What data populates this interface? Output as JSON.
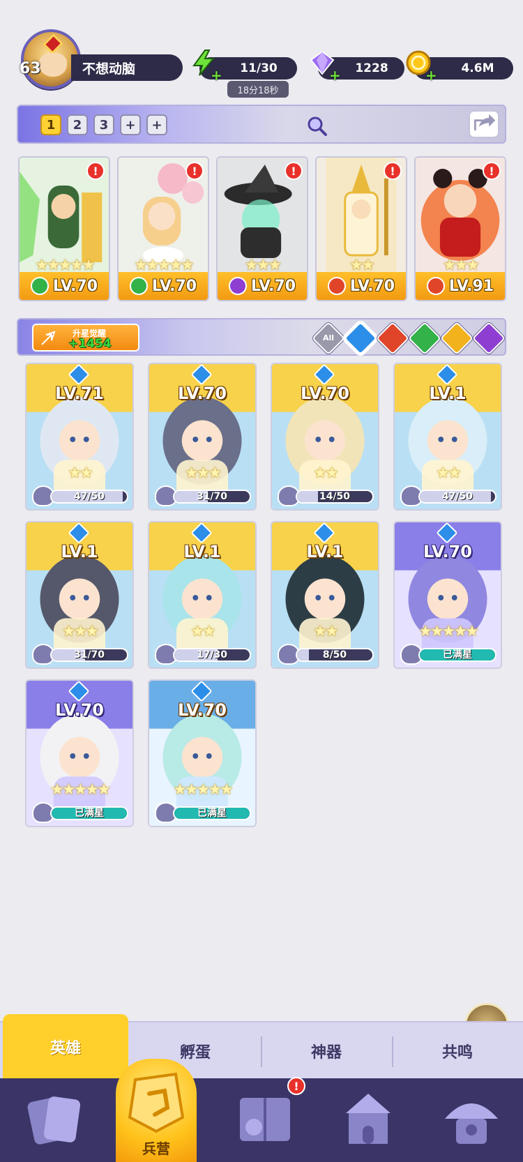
{
  "player": {
    "level": "63",
    "name": "不想动脑"
  },
  "resources": {
    "energy": "11/30",
    "energy_timer": "18分18秒",
    "gems": "1228",
    "gold": "4.6M"
  },
  "team_slots": [
    "1",
    "2",
    "3",
    "+",
    "+"
  ],
  "team": [
    {
      "element": "wind",
      "stars": 5,
      "level": "LV.70",
      "alert": "!"
    },
    {
      "element": "wind",
      "stars": 5,
      "level": "LV.70",
      "alert": "!"
    },
    {
      "element": "dark",
      "stars": 3,
      "level": "LV.70",
      "alert": "!"
    },
    {
      "element": "fire",
      "stars": 2,
      "level": "LV.70",
      "alert": "!"
    },
    {
      "element": "fire",
      "stars": 3,
      "level": "LV.91",
      "alert": "!"
    }
  ],
  "awaken": {
    "label": "升星觉醒",
    "value": "+1454"
  },
  "filters": [
    {
      "name": "all",
      "label": "All",
      "color": "#8a8aa0"
    },
    {
      "name": "water",
      "label": "",
      "color": "#2c8ee8"
    },
    {
      "name": "fire",
      "label": "",
      "color": "#e0452a"
    },
    {
      "name": "wind",
      "label": "",
      "color": "#33b24a"
    },
    {
      "name": "light",
      "label": "",
      "color": "#f2b21c"
    },
    {
      "name": "dark",
      "label": "",
      "color": "#8e3fd1"
    }
  ],
  "heroes": [
    {
      "level": "LV.71",
      "stars": 2,
      "progress": "47/50",
      "fill": 0.94,
      "theme": "gold"
    },
    {
      "level": "LV.70",
      "stars": 3,
      "progress": "31/70",
      "fill": 0.44,
      "theme": "gold"
    },
    {
      "level": "LV.70",
      "stars": 2,
      "progress": "14/50",
      "fill": 0.28,
      "theme": "gold"
    },
    {
      "level": "LV.1",
      "stars": 2,
      "progress": "47/50",
      "fill": 0.94,
      "theme": "gold"
    },
    {
      "level": "LV.1",
      "stars": 3,
      "progress": "31/70",
      "fill": 0.44,
      "theme": "gold"
    },
    {
      "level": "LV.1",
      "stars": 2,
      "progress": "17/30",
      "fill": 0.57,
      "theme": "gold"
    },
    {
      "level": "LV.1",
      "stars": 2,
      "progress": "8/50",
      "fill": 0.16,
      "theme": "gold"
    },
    {
      "level": "LV.70",
      "stars": 5,
      "progress": "已满星",
      "fill": 1,
      "theme": "purple"
    },
    {
      "level": "LV.70",
      "stars": 5,
      "progress": "已满星",
      "fill": 1,
      "theme": "purple"
    },
    {
      "level": "LV.70",
      "stars": 5,
      "progress": "已满星",
      "fill": 1,
      "theme": "blue"
    }
  ],
  "subtabs": [
    "英雄",
    "孵蛋",
    "神器",
    "共鸣"
  ],
  "nav": {
    "active_label": "兵营",
    "badge": "!"
  },
  "colors": {
    "background": "#ebebf0",
    "accent_yellow": "#ffd02b",
    "nav_bg": "#3a3566"
  }
}
